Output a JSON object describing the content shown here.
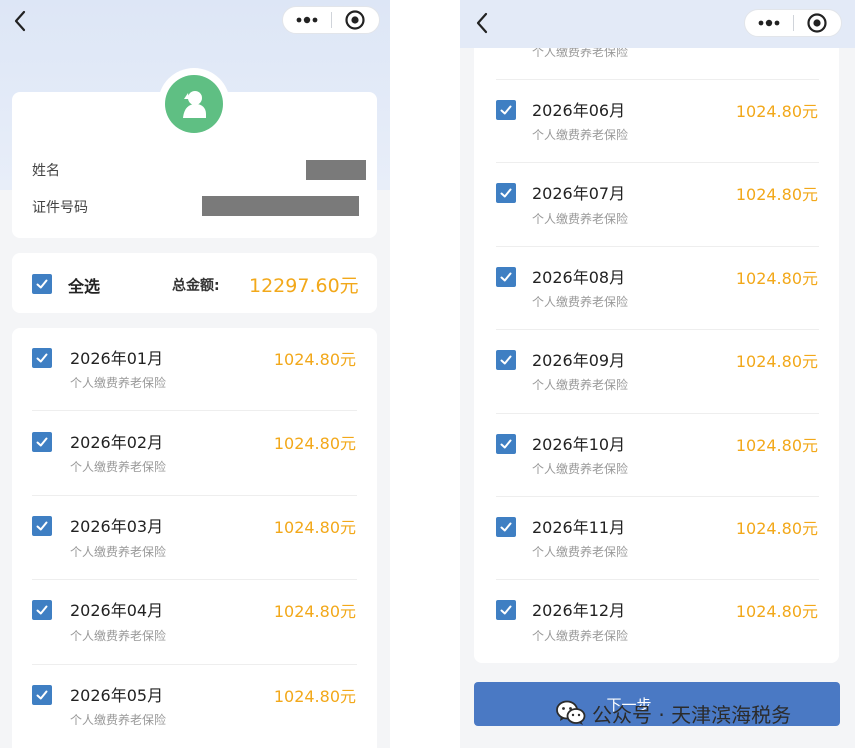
{
  "left": {
    "info": {
      "name_label": "姓名",
      "id_label": "证件号码"
    },
    "select_all": {
      "label": "全选",
      "total_label": "总金额:",
      "total_value": "12297.60元"
    },
    "items": [
      {
        "month": "2026年01月",
        "amount": "1024.80元",
        "desc": "个人缴费养老保险"
      },
      {
        "month": "2026年02月",
        "amount": "1024.80元",
        "desc": "个人缴费养老保险"
      },
      {
        "month": "2026年03月",
        "amount": "1024.80元",
        "desc": "个人缴费养老保险"
      },
      {
        "month": "2026年04月",
        "amount": "1024.80元",
        "desc": "个人缴费养老保险"
      },
      {
        "month": "2026年05月",
        "amount": "1024.80元",
        "desc": "个人缴费养老保险"
      }
    ]
  },
  "right": {
    "top_partial_desc": "个人缴费养老保险",
    "items": [
      {
        "month": "2026年06月",
        "amount": "1024.80元",
        "desc": "个人缴费养老保险"
      },
      {
        "month": "2026年07月",
        "amount": "1024.80元",
        "desc": "个人缴费养老保险"
      },
      {
        "month": "2026年08月",
        "amount": "1024.80元",
        "desc": "个人缴费养老保险"
      },
      {
        "month": "2026年09月",
        "amount": "1024.80元",
        "desc": "个人缴费养老保险"
      },
      {
        "month": "2026年10月",
        "amount": "1024.80元",
        "desc": "个人缴费养老保险"
      },
      {
        "month": "2026年11月",
        "amount": "1024.80元",
        "desc": "个人缴费养老保险"
      },
      {
        "month": "2026年12月",
        "amount": "1024.80元",
        "desc": "个人缴费养老保险"
      }
    ],
    "next_button": "下一步"
  },
  "watermark": {
    "text": "公众号 · 天津滨海税务"
  },
  "icons": {
    "back": "chevron-left-icon",
    "more": "more-dots-icon",
    "close": "target-close-icon",
    "avatar": "user-avatar-icon",
    "check": "checkmark-icon",
    "wechat": "wechat-logo-icon"
  },
  "colors": {
    "accent_blue": "#3f7fc3",
    "amount_orange": "#f2a81a",
    "button_blue": "#4a79c4",
    "avatar_green": "#5fbf83"
  }
}
